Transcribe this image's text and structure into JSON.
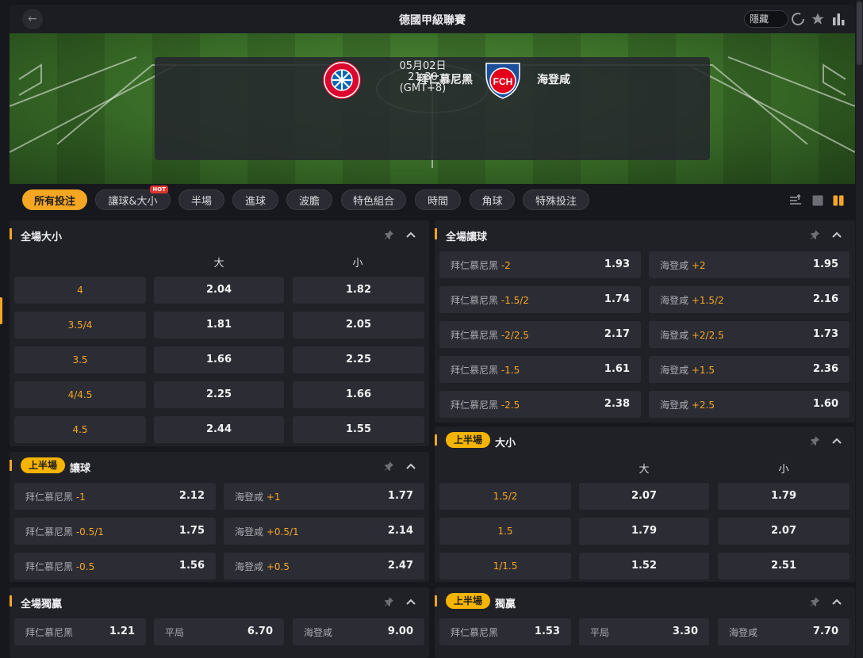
{
  "header": {
    "title": "德國甲級聯賽",
    "hide_label": "隱藏"
  },
  "match": {
    "home": "拜仁慕尼黑",
    "away": "海登咸",
    "date": "05月02日",
    "time": "21:30",
    "timezone": "(GMT+8)",
    "away_logo_text": "FCH"
  },
  "tabs": [
    {
      "label": "所有投注"
    },
    {
      "label": "讓球&大小",
      "badge": "HOT"
    },
    {
      "label": "半場"
    },
    {
      "label": "進球"
    },
    {
      "label": "波膽"
    },
    {
      "label": "特色組合"
    },
    {
      "label": "時間"
    },
    {
      "label": "角球"
    },
    {
      "label": "特殊投注"
    }
  ],
  "ft_total": {
    "title": "全場大小",
    "over": "大",
    "under": "小",
    "rows": [
      {
        "line": "4",
        "over": "2.04",
        "under": "1.82"
      },
      {
        "line": "3.5/4",
        "over": "1.81",
        "under": "2.05"
      },
      {
        "line": "3.5",
        "over": "1.66",
        "under": "2.25"
      },
      {
        "line": "4/4.5",
        "over": "2.25",
        "under": "1.66"
      },
      {
        "line": "4.5",
        "over": "2.44",
        "under": "1.55"
      }
    ]
  },
  "ft_handicap": {
    "title": "全場讓球",
    "rows": [
      {
        "home": "拜仁慕尼黑",
        "home_hcp": "-2",
        "home_odd": "1.93",
        "away": "海登咸",
        "away_hcp": "+2",
        "away_odd": "1.95"
      },
      {
        "home": "拜仁慕尼黑",
        "home_hcp": "-1.5/2",
        "home_odd": "1.74",
        "away": "海登咸",
        "away_hcp": "+1.5/2",
        "away_odd": "2.16"
      },
      {
        "home": "拜仁慕尼黑",
        "home_hcp": "-2/2.5",
        "home_odd": "2.17",
        "away": "海登咸",
        "away_hcp": "+2/2.5",
        "away_odd": "1.73"
      },
      {
        "home": "拜仁慕尼黑",
        "home_hcp": "-1.5",
        "home_odd": "1.61",
        "away": "海登咸",
        "away_hcp": "+1.5",
        "away_odd": "2.36"
      },
      {
        "home": "拜仁慕尼黑",
        "home_hcp": "-2.5",
        "home_odd": "2.38",
        "away": "海登咸",
        "away_hcp": "+2.5",
        "away_odd": "1.60"
      }
    ]
  },
  "ht_handicap": {
    "badge": "上半場",
    "title": "讓球",
    "rows": [
      {
        "home": "拜仁慕尼黑",
        "home_hcp": "-1",
        "home_odd": "2.12",
        "away": "海登咸",
        "away_hcp": "+1",
        "away_odd": "1.77"
      },
      {
        "home": "拜仁慕尼黑",
        "home_hcp": "-0.5/1",
        "home_odd": "1.75",
        "away": "海登咸",
        "away_hcp": "+0.5/1",
        "away_odd": "2.14"
      },
      {
        "home": "拜仁慕尼黑",
        "home_hcp": "-0.5",
        "home_odd": "1.56",
        "away": "海登咸",
        "away_hcp": "+0.5",
        "away_odd": "2.47"
      }
    ]
  },
  "ht_total": {
    "badge": "上半場",
    "title": "大小",
    "over": "大",
    "under": "小",
    "rows": [
      {
        "line": "1.5/2",
        "over": "2.07",
        "under": "1.79"
      },
      {
        "line": "1.5",
        "over": "1.79",
        "under": "2.07"
      },
      {
        "line": "1/1.5",
        "over": "1.52",
        "under": "2.51"
      }
    ]
  },
  "ft_1x2": {
    "title": "全場獨贏",
    "home": "拜仁慕尼黑",
    "home_odd": "1.21",
    "draw": "平局",
    "draw_odd": "6.70",
    "away": "海登咸",
    "away_odd": "9.00"
  },
  "ht_1x2": {
    "badge": "上半場",
    "title": "獨贏",
    "home": "拜仁慕尼黑",
    "home_odd": "1.53",
    "draw": "平局",
    "draw_odd": "3.30",
    "away": "海登咸",
    "away_odd": "7.70"
  },
  "colors": {
    "accent": "#f5a623",
    "badge": "#f5b400",
    "panel": "#202127",
    "cell": "#2c2d34"
  }
}
